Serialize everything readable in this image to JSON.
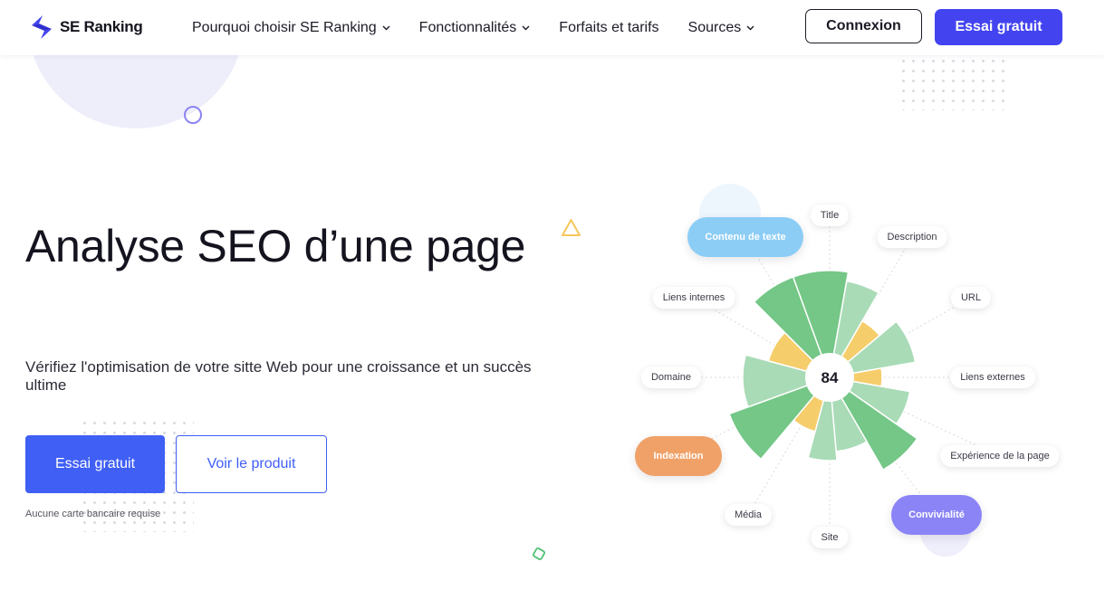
{
  "header": {
    "logo_text": "SE Ranking",
    "nav": [
      {
        "label": "Pourquoi choisir SE Ranking",
        "dropdown": true
      },
      {
        "label": "Fonctionnalités",
        "dropdown": true
      },
      {
        "label": "Forfaits et tarifs",
        "dropdown": false
      },
      {
        "label": "Sources",
        "dropdown": true
      }
    ],
    "login_label": "Connexion",
    "trial_label": "Essai gratuit"
  },
  "hero": {
    "title": "Analyse SEO d’une page",
    "subtitle": "Vérifiez l'optimisation de votre sitte Web pour une croissance et un succès ultime",
    "primary_button": "Essai gratuit",
    "secondary_button": "Voir le produit",
    "note": "Aucune carte bancaire requise"
  },
  "score_chart": {
    "score": "84",
    "labels": [
      "Title",
      "Description",
      "URL",
      "Liens externes",
      "Expérience de la page",
      "Site",
      "Média",
      "Domaine",
      "Liens internes"
    ],
    "pills": [
      "Contenu de texte",
      "Indexation",
      "Convivialité"
    ]
  },
  "colors": {
    "brand": "#4344f0",
    "cta": "#3f5ff5",
    "green_dark": "#74c786",
    "green_light": "#a9dbb6",
    "yellow": "#f5cd6b",
    "pill_blue": "#8ccdf6",
    "pill_orange": "#f0a168",
    "pill_purple": "#8b84f6"
  }
}
